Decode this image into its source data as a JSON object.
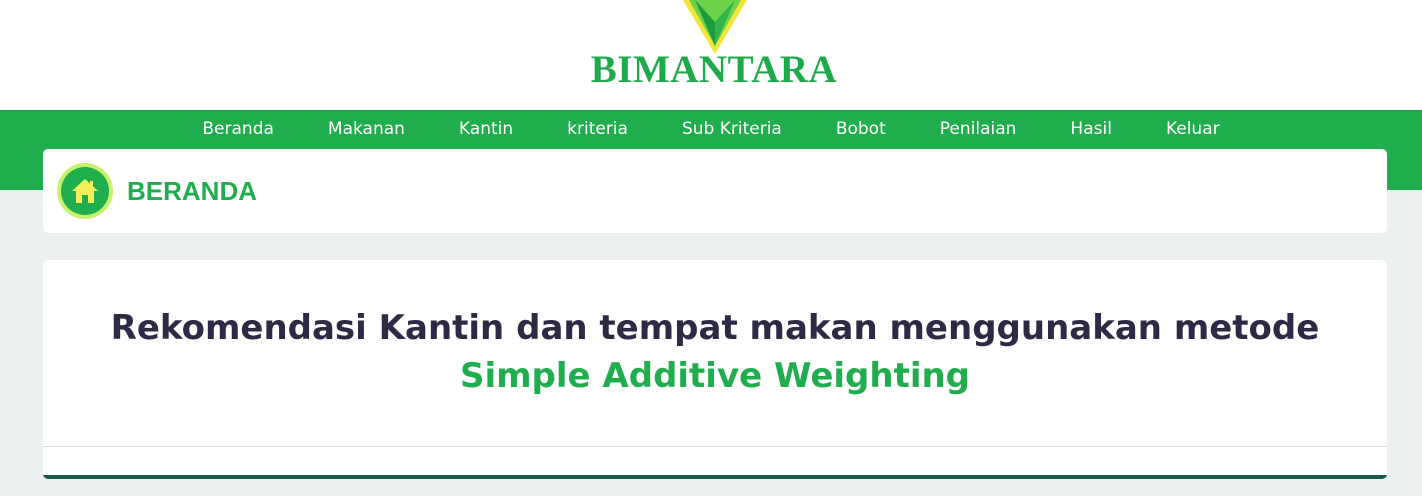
{
  "header": {
    "brand": "BIMANTARA",
    "logo_icon": "triangle-logo-icon"
  },
  "nav": {
    "items": [
      {
        "label": "Beranda"
      },
      {
        "label": "Makanan"
      },
      {
        "label": "Kantin"
      },
      {
        "label": "kriteria"
      },
      {
        "label": "Sub Kriteria"
      },
      {
        "label": "Bobot"
      },
      {
        "label": "Penilaian"
      },
      {
        "label": "Hasil"
      },
      {
        "label": "Keluar"
      }
    ]
  },
  "page": {
    "title": "BERANDA",
    "icon": "home-icon"
  },
  "card": {
    "heading_line1": "Rekomendasi Kantin dan tempat makan menggunakan metode",
    "heading_line2": "Simple Additive Weighting"
  },
  "colors": {
    "primary": "#1fad4d",
    "accent": "#c8f26a",
    "background": "#ecf0f1",
    "heading": "#2e2a46",
    "footer_bar": "#17584a"
  }
}
